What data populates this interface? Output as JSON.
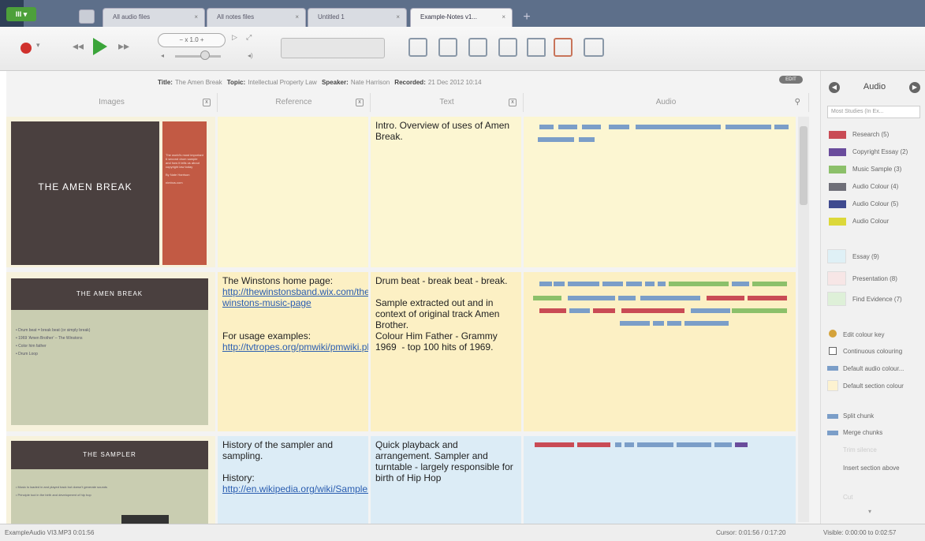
{
  "app": {
    "menu_label": "III ▾"
  },
  "tabs": [
    {
      "label": "All audio files",
      "close": "×"
    },
    {
      "label": "All notes files",
      "close": "×"
    },
    {
      "label": "Untitled 1",
      "close": "×"
    },
    {
      "label": "Example-Notes v1...",
      "close": "×"
    }
  ],
  "new_tab": "+",
  "toolbar": {
    "speed_label": "− x 1.0 +",
    "rec_menu": "▾"
  },
  "info": {
    "title_label": "Title:",
    "title": "The Amen Break",
    "topic_label": "Topic:",
    "topic": "Intellectual Property Law",
    "speaker_label": "Speaker:",
    "speaker": "Nate Harrison",
    "recorded_label": "Recorded:",
    "recorded": "21 Dec 2012 10:14",
    "edit_label": "EDIT"
  },
  "columns": [
    {
      "label": "Images",
      "close": "x"
    },
    {
      "label": "Reference",
      "close": "x"
    },
    {
      "label": "Text",
      "close": "x"
    },
    {
      "label": "Audio"
    }
  ],
  "rows": [
    {
      "slide_title": "THE AMEN BREAK",
      "slide_side": "The world's most important 6 second drum sample and how it tells us about copyright law today\n\nBy Nate Harrison\n\nnimbus.com",
      "reference": "",
      "text": "Intro. Overview of uses of Amen Break."
    },
    {
      "slide_title": "THE AMEN BREAK",
      "slide_bullets": "• Drum beat = break beat (or simply break)\n\n• 1969 'Amen Brother' – The Winstons\n\n• Color him father\n\n• Drum Loop",
      "ref_intro": "The Winstons home page:",
      "ref_link1": "http://thewinstonsband.wix.com/the-winstons-music-page",
      "ref_mid": "For usage examples:",
      "ref_link2": "http://tvtropes.org/pmwiki/pmwiki.php/Main/AmenBreak",
      "text": "Drum beat - break beat - break.\n\nSample extracted out and in context of original track Amen Brother.\nColour Him Father - Grammy 1969  - top 100 hits of 1969."
    },
    {
      "slide_title": "THE SAMPLER",
      "slide_bullets": "• Music is loaded in and played back but doesn't generate sounds\n\n• Principle tool in the birth and development of hip hop",
      "ref_intro": "History of the sampler and sampling.\n\nHistory:",
      "ref_link1": "http://en.wikipedia.org/wiki/Sampler_(musical_instrument)",
      "text": "Quick playback and arrangement. Sampler and turntable - largely responsible for birth of Hip Hop"
    }
  ],
  "panel": {
    "title": "Audio",
    "prev": "◀",
    "next": "▶",
    "dropdown": "Most Studies (In Ex...",
    "legend": [
      {
        "label": "Research (5)",
        "color": "#c94b55"
      },
      {
        "label": "Copyright Essay (2)",
        "color": "#6a4c9c"
      },
      {
        "label": "Music Sample (3)",
        "color": "#8cc06a"
      },
      {
        "label": "Audio Colour (4)",
        "color": "#6f6f78"
      },
      {
        "label": "Audio Colour (5)",
        "color": "#3f4a8f"
      },
      {
        "label": "Audio Colour",
        "color": "#dcd83a"
      }
    ],
    "sections": [
      {
        "label": "Essay (9)",
        "color": "#dff0f6"
      },
      {
        "label": "Presentation (8)",
        "color": "#f7e6e6"
      },
      {
        "label": "Find Evidence (7)",
        "color": "#def0d8"
      }
    ],
    "edit_key": "Edit colour key",
    "continuous": "Continuous colouring",
    "default_audio": "Default audio colour...",
    "default_section": "Default section colour",
    "split": "Split chunk",
    "merge": "Merge chunks",
    "trim": "Trim silence",
    "insert": "Insert section above",
    "cut": "Cut"
  },
  "status": {
    "file": "ExampleAudio VI3.MP3 0:01:56",
    "cursor": "Cursor: 0:01:56 / 0:17:20",
    "visible": "Visible: 0:00:00 to 0:02:57"
  }
}
